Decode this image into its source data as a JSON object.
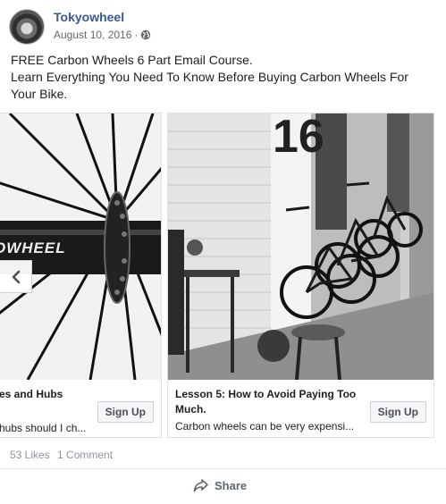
{
  "post": {
    "page_name": "Tokyowheel",
    "date": "August 10, 2016",
    "separator": "·",
    "privacy_icon": "globe-icon",
    "text_line1": "FREE Carbon Wheels 6 Part Email Course.",
    "text_line2": "Learn Everything You Need To Know Before Buying Carbon Wheels For",
    "text_line3": "Your Bike."
  },
  "carousel": {
    "prev_icon": "chevron-left-icon",
    "cards": [
      {
        "title": "es and Hubs",
        "description": "hubs should I ch...",
        "cta": "Sign Up",
        "image_text": "OWHEEL"
      },
      {
        "title_line1": "Lesson 5: How to Avoid Paying Too",
        "title_line2": "Much.",
        "description": "Carbon wheels can be very expensi...",
        "cta": "Sign Up",
        "image_text": "16"
      }
    ]
  },
  "stats": {
    "likes": "53 Likes",
    "comments": "1 Comment"
  },
  "actions": {
    "share_label": "Share",
    "share_icon": "share-arrow-icon"
  },
  "colors": {
    "link": "#385898",
    "muted": "#606770",
    "border": "#dddfe2"
  }
}
